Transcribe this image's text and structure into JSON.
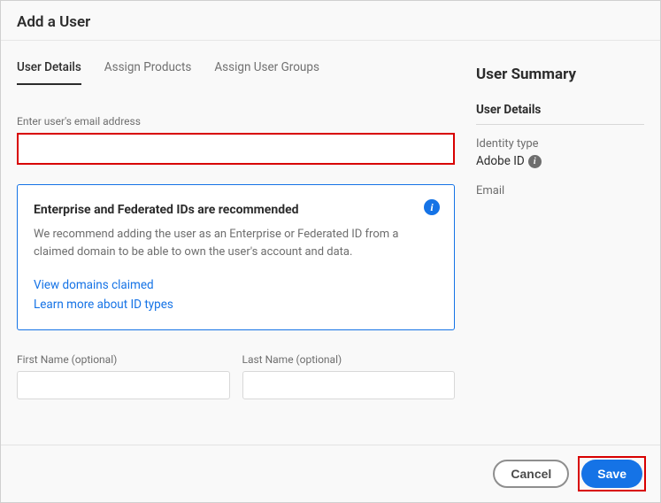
{
  "header": {
    "title": "Add a User"
  },
  "tabs": [
    {
      "label": "User Details",
      "active": true
    },
    {
      "label": "Assign Products",
      "active": false
    },
    {
      "label": "Assign User Groups",
      "active": false
    }
  ],
  "email": {
    "label": "Enter user's email address",
    "value": ""
  },
  "info_card": {
    "title": "Enterprise and Federated IDs are recommended",
    "body": "We recommend adding the user as an Enterprise or Federated ID from a claimed domain to be able to own the user's account and data.",
    "link_domains": "View domains claimed",
    "link_learn": "Learn more about ID types"
  },
  "first_name": {
    "label": "First Name (optional)",
    "value": ""
  },
  "last_name": {
    "label": "Last Name (optional)",
    "value": ""
  },
  "summary": {
    "title": "User Summary",
    "section": "User Details",
    "identity_label": "Identity type",
    "identity_value": "Adobe ID",
    "email_label": "Email"
  },
  "footer": {
    "cancel": "Cancel",
    "save": "Save"
  }
}
